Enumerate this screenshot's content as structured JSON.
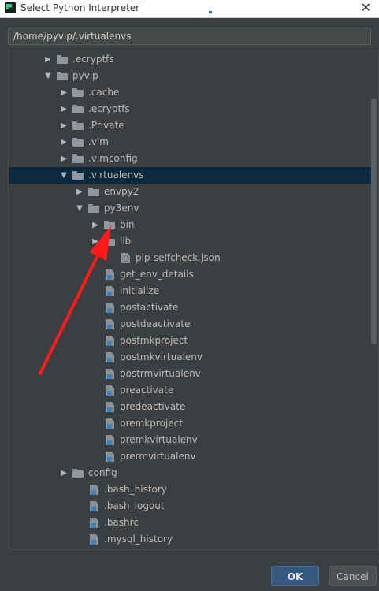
{
  "window": {
    "title": "Select Python Interpreter",
    "close_glyph": "✕"
  },
  "path": {
    "value": "/home/pyvip/.virtualenvs"
  },
  "tree": {
    "rows": [
      {
        "label": ".ecryptfs",
        "type": "folder",
        "expanded": false
      },
      {
        "label": "pyvip",
        "type": "folder",
        "expanded": true
      },
      {
        "label": ".cache",
        "type": "folder",
        "expanded": false
      },
      {
        "label": ".ecryptfs",
        "type": "folder",
        "expanded": false
      },
      {
        "label": ".Private",
        "type": "folder",
        "expanded": false
      },
      {
        "label": ".vim",
        "type": "folder",
        "expanded": false
      },
      {
        "label": ".vimconfig",
        "type": "folder",
        "expanded": false
      },
      {
        "label": ".virtualenvs",
        "type": "folder",
        "expanded": true,
        "selected": true
      },
      {
        "label": "envpy2",
        "type": "folder",
        "expanded": false
      },
      {
        "label": "py3env",
        "type": "folder",
        "expanded": true
      },
      {
        "label": "bin",
        "type": "folder",
        "expanded": false
      },
      {
        "label": "lib",
        "type": "folder",
        "expanded": false
      },
      {
        "label": "pip-selfcheck.json",
        "type": "json"
      },
      {
        "label": "get_env_details",
        "type": "file"
      },
      {
        "label": "initialize",
        "type": "file"
      },
      {
        "label": "postactivate",
        "type": "file"
      },
      {
        "label": "postdeactivate",
        "type": "file"
      },
      {
        "label": "postmkproject",
        "type": "file"
      },
      {
        "label": "postmkvirtualenv",
        "type": "file"
      },
      {
        "label": "postrmvirtualenv",
        "type": "file"
      },
      {
        "label": "preactivate",
        "type": "file"
      },
      {
        "label": "predeactivate",
        "type": "file"
      },
      {
        "label": "premkproject",
        "type": "file"
      },
      {
        "label": "premkvirtualenv",
        "type": "file"
      },
      {
        "label": "prermvirtualenv",
        "type": "file"
      },
      {
        "label": "config",
        "type": "folder",
        "expanded": false
      },
      {
        "label": ".bash_history",
        "type": "file"
      },
      {
        "label": ".bash_logout",
        "type": "file"
      },
      {
        "label": ".bashrc",
        "type": "file"
      },
      {
        "label": ".mysql_history",
        "type": "file"
      }
    ]
  },
  "buttons": {
    "ok": "OK",
    "cancel": "Cancel"
  },
  "colors": {
    "background": "#3c3f41",
    "selection": "#0d293e",
    "ok_button": "#365880",
    "annotation_arrow": "#ff1a1a"
  }
}
